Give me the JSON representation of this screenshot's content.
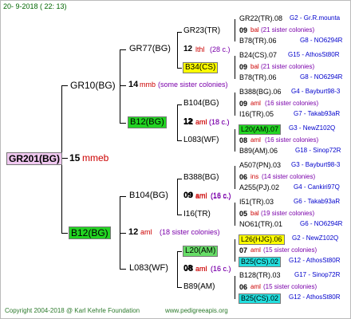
{
  "header": {
    "date": "20-  9-2018  ( 22: 13)"
  },
  "root": {
    "name": "GR201(BG)",
    "age": "15",
    "unit": "mmeb"
  },
  "gen1": [
    {
      "name": "GR10(BG)",
      "age": "14",
      "unit": "mmb",
      "note": "(some sister colonies)"
    },
    {
      "name": "B12(BG)",
      "age": "12",
      "unit": "aml",
      "note": "(18 sister colonies)"
    }
  ],
  "gen2": [
    {
      "name": "GR77(BG)"
    },
    {
      "name": "B12(BG)",
      "age": "12",
      "unit": "aml",
      "note": "(18 c.)"
    },
    {
      "name": "B104(BG)",
      "age": "09",
      "unit": "aml",
      "note": "(16 c.)"
    },
    {
      "name": "L083(WF)",
      "age": "08",
      "unit": "aml",
      "note": "(16 c.)"
    }
  ],
  "gen3": [
    {
      "name": "GR23(TR)",
      "age": "12",
      "unit": "lthl",
      "note": "(28 c.)"
    },
    {
      "name": "B34(CS)"
    },
    {
      "name": "B104(BG)",
      "age": "12",
      "unit": "aml",
      "note": "(18 c.)"
    },
    {
      "name": "L083(WF)"
    },
    {
      "name": "B388(BG)",
      "age": "09",
      "unit": "aml",
      "note": "(16 c.)"
    },
    {
      "name": "I16(TR)"
    },
    {
      "name": "L20(AM)",
      "age": "08",
      "unit": "aml",
      "note": "(16 c.)"
    },
    {
      "name": "B89(AM)"
    }
  ],
  "gen4": [
    {
      "name": "GR22(TR).08",
      "info": "G2 - Gr.R.mounta"
    },
    {
      "age": "09",
      "unit": "bal",
      "note": "(21 sister colonies)"
    },
    {
      "name": "B78(TR).06",
      "info": "G8 - NO6294R"
    },
    {
      "name": "B24(CS).07",
      "info": "G15 - AthosSt80R"
    },
    {
      "age": "09",
      "unit": "bal",
      "note": "(21 sister colonies)"
    },
    {
      "name": "B78(TR).06",
      "info": "G8 - NO6294R"
    },
    {
      "name": "B388(BG).06",
      "info": "G4 - Bayburt98-3"
    },
    {
      "age": "09",
      "unit": "aml",
      "note": "(16 sister colonies)"
    },
    {
      "name": "I16(TR).05",
      "info": "G7 - Takab93aR"
    },
    {
      "name": "L20(AM).07",
      "info": "G3 - NewZ102Q"
    },
    {
      "age": "08",
      "unit": "aml",
      "note": "(16 sister colonies)"
    },
    {
      "name": "B89(AM).06",
      "info": "G18 - Sinop72R"
    },
    {
      "name": "A507(PN).03",
      "info": "G3 - Bayburt98-3"
    },
    {
      "age": "06",
      "unit": "ins",
      "note": "(14 sister colonies)"
    },
    {
      "name": "A255(PJ).02",
      "info": "G4 - Cankiri97Q"
    },
    {
      "name": "I51(TR).03",
      "info": "G6 - Takab93aR"
    },
    {
      "age": "05",
      "unit": "bal",
      "note": "(19 sister colonies)"
    },
    {
      "name": "NO61(TR).01",
      "info": "G6 - NO6294R"
    },
    {
      "name": "L26(HJG).06",
      "info": "G2 - NewZ102Q"
    },
    {
      "age": "07",
      "unit": "aml",
      "note": "(15 sister colonies)"
    },
    {
      "name": "B25(CS).02",
      "info": "G12 - AthosSt80R"
    },
    {
      "name": "B128(TR).03",
      "info": "G17 - Sinop72R"
    },
    {
      "age": "06",
      "unit": "aml",
      "note": "(15 sister colonies)"
    },
    {
      "name": "B25(CS).02",
      "info": "G12 - AthosSt80R"
    }
  ],
  "footer": {
    "copyright": "Copyright 2004-2018 @ Karl Kehrle Foundation",
    "url": "www.pedigreeapis.org"
  }
}
